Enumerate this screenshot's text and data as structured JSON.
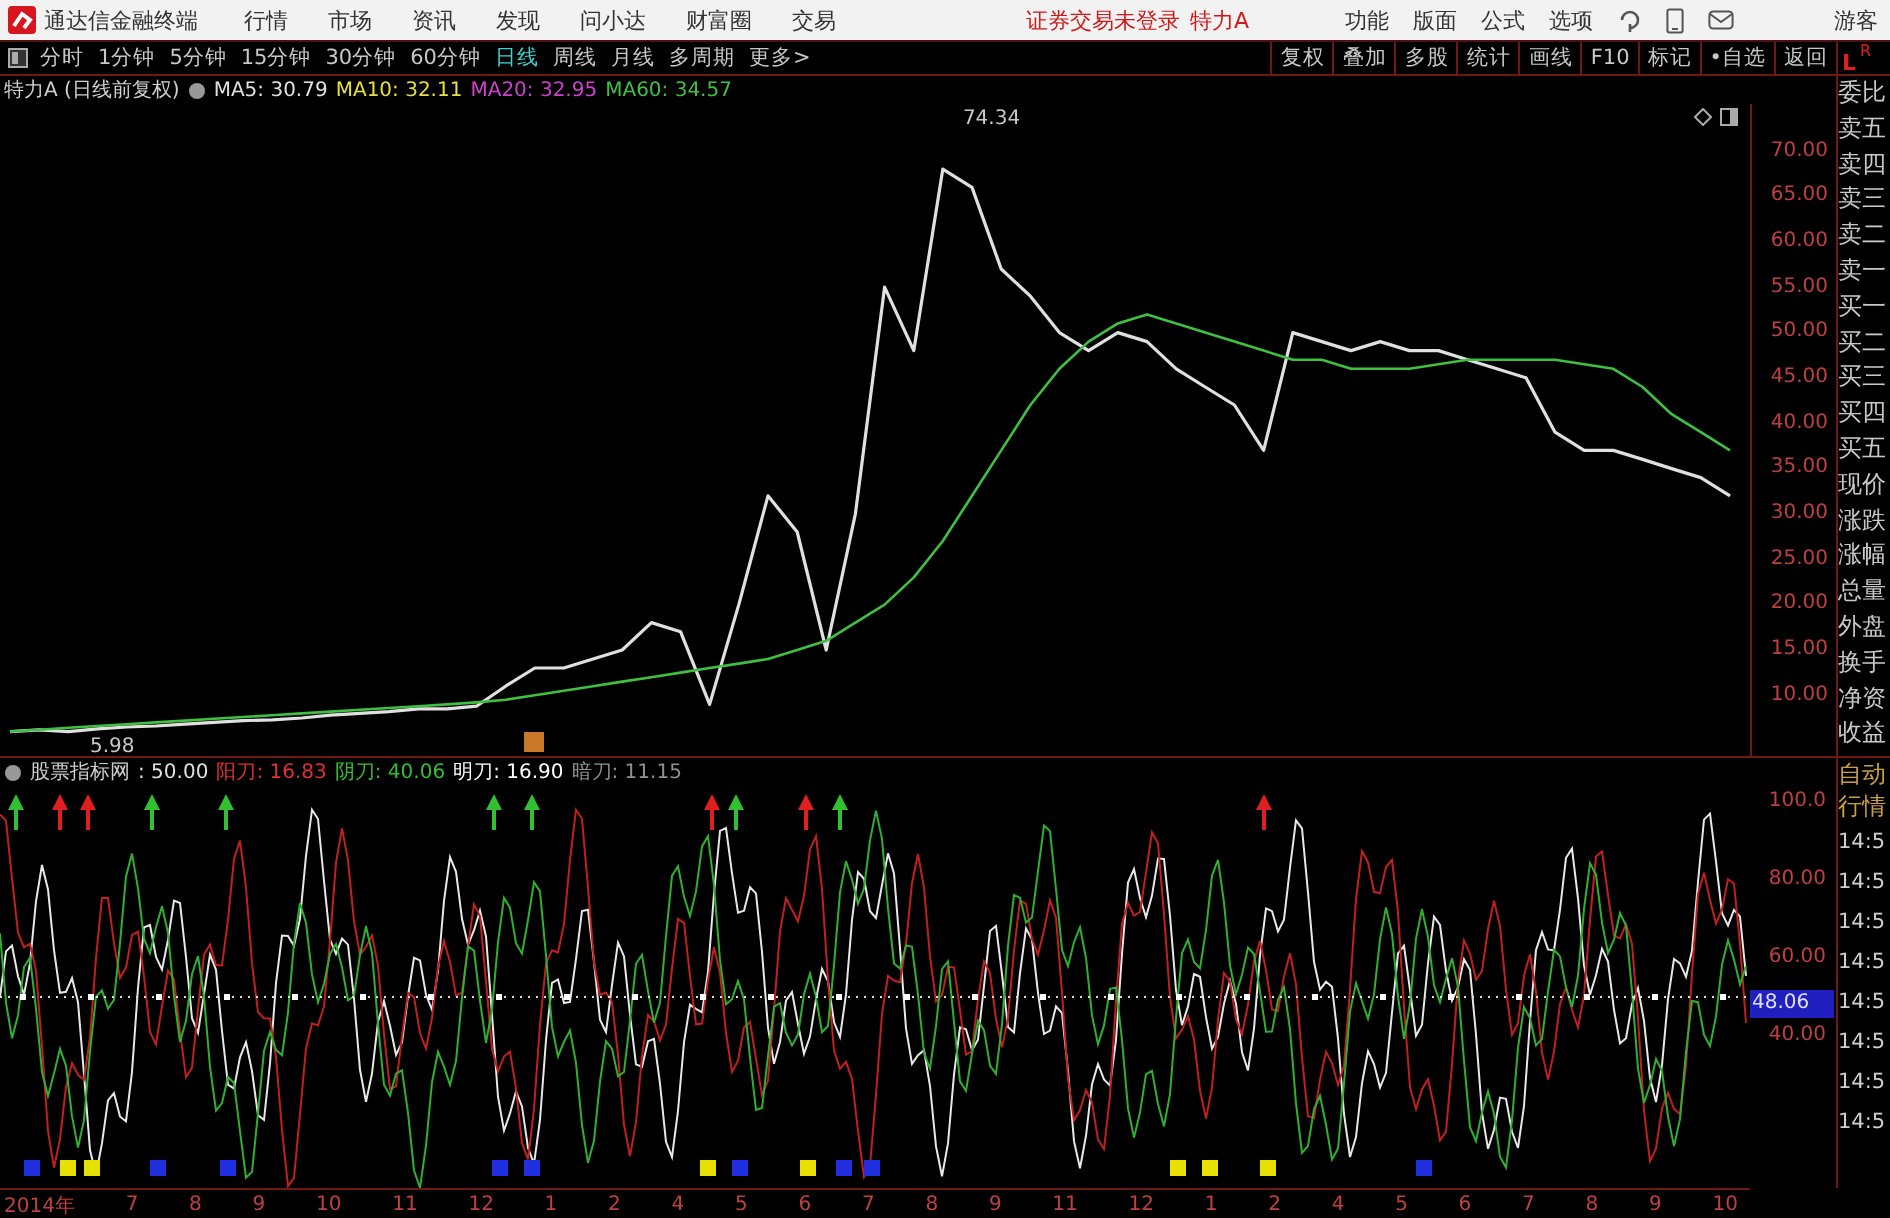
{
  "menubar": {
    "app_title": "通达信金融终端",
    "menus": [
      "行情",
      "市场",
      "资讯",
      "发现",
      "问小达",
      "财富圈",
      "交易"
    ],
    "login_status": "证券交易未登录",
    "stock_name": "特力A",
    "tools": [
      "功能",
      "版面",
      "公式",
      "选项"
    ],
    "user": "游客"
  },
  "toolbar": {
    "periods": [
      {
        "label": "分时",
        "selected": false
      },
      {
        "label": "1分钟",
        "selected": false
      },
      {
        "label": "5分钟",
        "selected": false
      },
      {
        "label": "15分钟",
        "selected": false
      },
      {
        "label": "30分钟",
        "selected": false
      },
      {
        "label": "60分钟",
        "selected": false
      },
      {
        "label": "日线",
        "selected": true
      },
      {
        "label": "周线",
        "selected": false
      },
      {
        "label": "月线",
        "selected": false
      },
      {
        "label": "多周期",
        "selected": false
      },
      {
        "label": "更多>",
        "selected": false
      }
    ],
    "actions": [
      "复权",
      "叠加",
      "多股",
      "统计",
      "画线",
      "F10",
      "标记",
      "•自选",
      "返回"
    ],
    "side_header": [
      "L",
      "R"
    ]
  },
  "main_chart": {
    "title": "特力A (日线前复权)",
    "indicators": [
      {
        "text": "MA5: 30.79",
        "color": "#e0e0e0"
      },
      {
        "text": "MA10: 32.11",
        "color": "#e8e040"
      },
      {
        "text": "MA20: 32.95",
        "color": "#d040d0"
      },
      {
        "text": "MA60: 34.57",
        "color": "#40c040"
      }
    ],
    "high_label": "74.34",
    "low_label": "5.98",
    "chart_data": {
      "type": "line",
      "ylim": [
        3.3,
        75.2
      ],
      "yticks": [
        {
          "value": 10,
          "label": "10.00"
        },
        {
          "value": 15,
          "label": "15.00"
        },
        {
          "value": 20,
          "label": "20.00"
        },
        {
          "value": 25,
          "label": "25.00"
        },
        {
          "value": 30,
          "label": "30.00"
        },
        {
          "value": 35,
          "label": "35.00"
        },
        {
          "value": 40,
          "label": "40.00"
        },
        {
          "value": 45,
          "label": "45.00"
        },
        {
          "value": 50,
          "label": "50.00"
        },
        {
          "value": 55,
          "label": "55.00"
        },
        {
          "value": 60,
          "label": "60.00"
        },
        {
          "value": 65,
          "label": "65.00"
        },
        {
          "value": 70,
          "label": "70.00"
        }
      ],
      "series": [
        {
          "color": "#e0e0e0",
          "values": [
            6,
            6.2,
            6,
            6.3,
            6.5,
            6.6,
            6.8,
            7,
            7.2,
            7.3,
            7.5,
            7.8,
            8,
            8.2,
            8.5,
            8.5,
            8.8,
            11,
            13,
            13,
            14,
            15,
            18,
            17,
            9,
            20,
            32,
            28,
            15,
            30,
            55,
            48,
            68,
            66,
            57,
            54,
            50,
            48,
            50,
            49,
            46,
            44,
            42,
            37,
            50,
            49,
            48,
            49,
            48,
            48,
            47,
            46,
            45,
            39,
            37,
            37,
            36,
            35,
            34,
            32
          ]
        },
        {
          "color": "#40c040",
          "values": [
            6,
            6.2,
            6.4,
            6.6,
            6.8,
            7,
            7.2,
            7.4,
            7.6,
            7.8,
            8,
            8.2,
            8.4,
            8.6,
            8.8,
            9,
            9.2,
            9.5,
            10,
            10.5,
            11,
            11.5,
            12,
            12.5,
            13,
            13.5,
            14,
            15,
            16,
            18,
            20,
            23,
            27,
            32,
            37,
            42,
            46,
            49,
            51,
            52,
            51,
            50,
            49,
            48,
            47,
            47,
            46,
            46,
            46,
            46.5,
            47,
            47,
            47,
            47,
            46.5,
            46,
            44,
            41,
            39,
            37
          ]
        }
      ]
    }
  },
  "quote_panel": [
    "委比",
    "卖五",
    "卖四",
    "卖三",
    "卖二",
    "卖一",
    "买一",
    "买二",
    "买三",
    "买四",
    "买五",
    "现价",
    "涨跌",
    "涨幅",
    "总量",
    "外盘",
    "换手",
    "净资",
    "收益"
  ],
  "indicator_pane": {
    "name": "股票指标网",
    "values": [
      {
        "text": ": 50.00",
        "color": "#e0e0e0"
      },
      {
        "text": "阳刀: 16.83",
        "color": "#e03030"
      },
      {
        "text": "阴刀: 40.06",
        "color": "#30c030"
      },
      {
        "text": "明刀: 16.90",
        "color": "#ffffff"
      },
      {
        "text": "暗刀: 11.15",
        "color": "#909090"
      }
    ],
    "axis_labels": [
      {
        "text": "100.0",
        "highlighted": false
      },
      {
        "text": "80.00",
        "highlighted": false
      },
      {
        "text": "60.00",
        "highlighted": false
      },
      {
        "text": "48.06",
        "highlighted": true
      },
      {
        "text": "40.00",
        "highlighted": false
      }
    ]
  },
  "trade_panel": {
    "header": [
      "自动",
      "行情"
    ],
    "times": [
      "14:5",
      "14:5",
      "14:5",
      "14:5",
      "14:5",
      "14:5",
      "14:5",
      "14:5"
    ]
  },
  "date_axis": [
    "2014年",
    "7",
    "8",
    "9",
    "10",
    "11",
    "12",
    "1",
    "2",
    "4",
    "5",
    "6",
    "7",
    "8",
    "9",
    "11",
    "12",
    "1",
    "2",
    "4",
    "5",
    "6",
    "7",
    "8",
    "9",
    "10"
  ]
}
